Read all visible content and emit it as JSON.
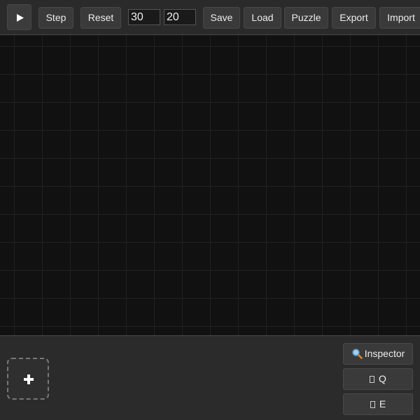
{
  "toolbar": {
    "play_icon": "play-icon",
    "step_label": "Step",
    "reset_label": "Reset",
    "width_value": "30",
    "height_value": "20",
    "save_label": "Save",
    "load_label": "Load",
    "puzzle_label": "Puzzle",
    "export_label": "Export",
    "import_label": "Import"
  },
  "canvas": {
    "background_color": "#111111",
    "grid_color": "#212121"
  },
  "bottom_panel": {
    "add_icon": "plus-icon",
    "inspector_label": "Inspector",
    "inspector_icon": "magnifier-icon",
    "rotate_q_label": "Q",
    "rotate_e_label": "E",
    "missing_glyph_icon": "missing-glyph-icon"
  }
}
